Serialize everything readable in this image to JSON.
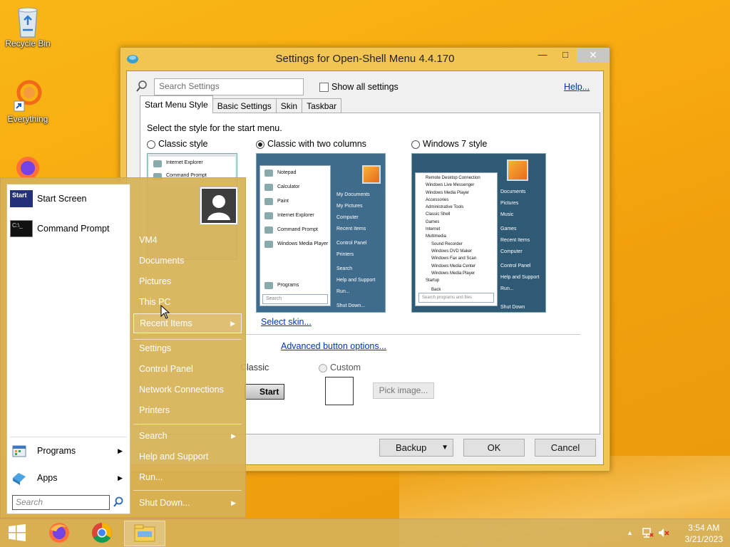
{
  "desktop": {
    "icons": [
      {
        "label": "Recycle Bin"
      },
      {
        "label": "Everything"
      }
    ]
  },
  "window": {
    "title": "Settings for Open-Shell Menu 4.4.170",
    "search_placeholder": "Search Settings",
    "show_all_label": "Show all settings",
    "help_label": "Help...",
    "tabs": [
      "Start Menu Style",
      "Basic Settings",
      "Skin",
      "Taskbar"
    ],
    "active_tab": "Start Menu Style",
    "select_style_label": "Select the style for the start menu.",
    "styles": [
      {
        "label": "Classic style",
        "selected": false
      },
      {
        "label": "Classic with two columns",
        "selected": true
      },
      {
        "label": "Windows 7 style",
        "selected": false
      }
    ],
    "select_skin_link": "Select skin...",
    "advanced_button_link": "Advanced button options...",
    "button_look": {
      "classic_label": "Classic",
      "custom_label": "Custom",
      "start_button_text": "Start",
      "pick_image_label": "Pick image..."
    },
    "footer": {
      "backup_label": "Backup",
      "ok_label": "OK",
      "cancel_label": "Cancel"
    },
    "preview_two_col": {
      "left_items": [
        "Notepad",
        "Calculator",
        "Paint",
        "Internet Explorer",
        "Command Prompt",
        "Windows Media Player"
      ],
      "programs": "Programs",
      "search": "Search",
      "right_items": [
        "My Documents",
        "My Pictures",
        "Computer",
        "Recent Items",
        "Control Panel",
        "Printers",
        "Search",
        "Help and Support",
        "Run...",
        "Shut Down..."
      ]
    },
    "preview_win7": {
      "left_items": [
        "Remote Desktop Connection",
        "Windows Live Messenger",
        "Windows Media Player",
        "Accessories",
        "Administrative Tools",
        "Classic Shell",
        "Games",
        "Internet",
        "Multimedia",
        "Sound Recorder",
        "Windows DVD Maker",
        "Windows Fax and Scan",
        "Windows Media Center",
        "Windows Media Player",
        "Startup"
      ],
      "back": "Back",
      "search": "Search programs and files",
      "right_items": [
        "Documents",
        "Pictures",
        "Music",
        "Games",
        "Recent Items",
        "Computer",
        "Control Panel",
        "Help and Support",
        "Run..."
      ],
      "shutdown": "Shut Down"
    },
    "preview_classic": {
      "items": [
        "Internet Explorer",
        "Command Prompt"
      ]
    }
  },
  "start_menu": {
    "pinned": [
      {
        "label": "Start Screen",
        "icon": "start-screen-icon"
      },
      {
        "label": "Command Prompt",
        "icon": "cmd-icon"
      }
    ],
    "programs_label": "Programs",
    "apps_label": "Apps",
    "search_placeholder": "Search",
    "right_items": [
      {
        "label": "VM4",
        "arrow": false
      },
      {
        "label": "Documents",
        "arrow": false
      },
      {
        "label": "Pictures",
        "arrow": false
      },
      {
        "label": "This PC",
        "arrow": false
      },
      {
        "label": "Recent Items",
        "arrow": true
      },
      {
        "label": "Settings",
        "arrow": false
      },
      {
        "label": "Control Panel",
        "arrow": false
      },
      {
        "label": "Network Connections",
        "arrow": false
      },
      {
        "label": "Printers",
        "arrow": false
      },
      {
        "label": "Search",
        "arrow": true
      },
      {
        "label": "Help and Support",
        "arrow": false
      },
      {
        "label": "Run...",
        "arrow": false
      },
      {
        "label": "Shut Down...",
        "arrow": true
      }
    ]
  },
  "taskbar": {
    "apps": [
      "windows-start-icon",
      "firefox-icon",
      "chrome-icon",
      "file-explorer-icon"
    ],
    "clock": {
      "time": "3:54 AM",
      "date": "3/21/2023"
    }
  },
  "colors": {
    "accent_link": "#0033cc",
    "window_frame": "#f2c552",
    "wallpaper": "#f7a90f"
  }
}
